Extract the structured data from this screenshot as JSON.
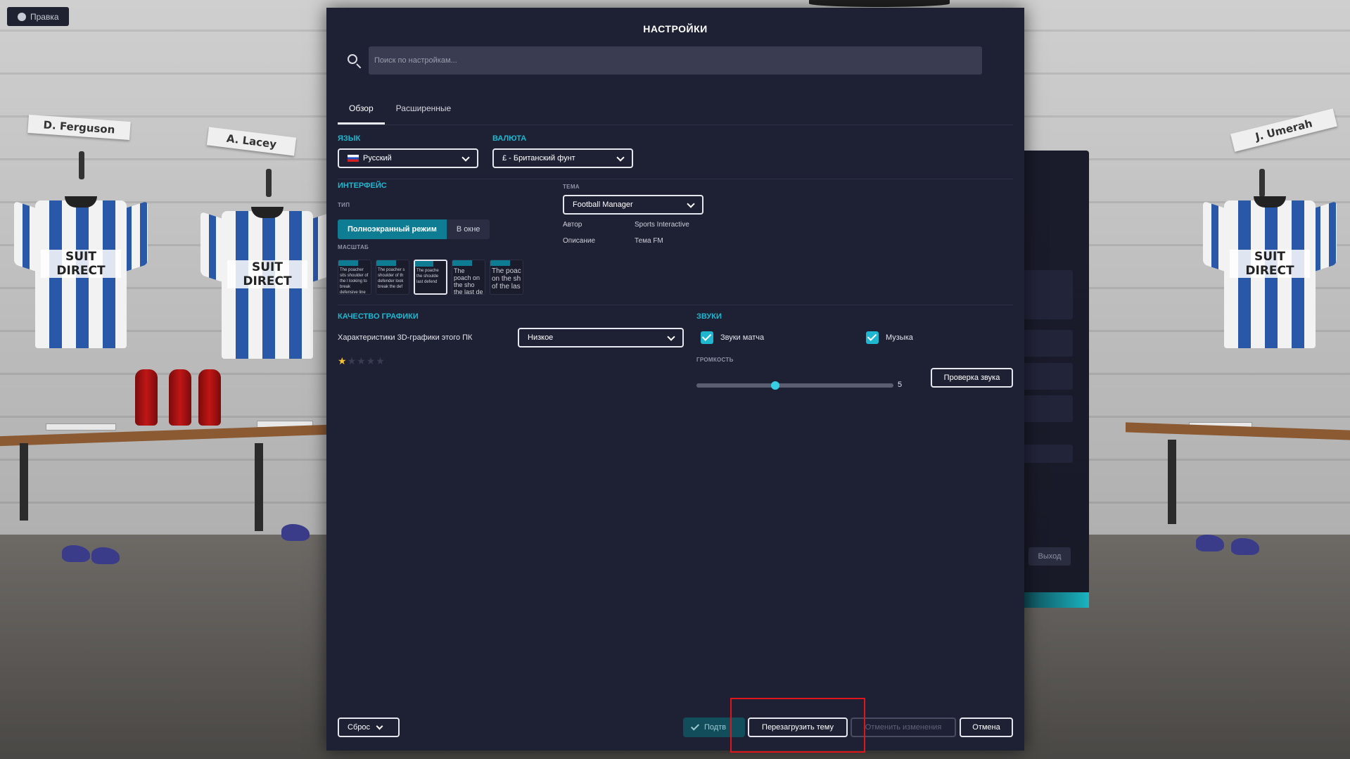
{
  "top_left": {
    "label": "Правка"
  },
  "background": {
    "nameplates": [
      "D. Ferguson",
      "A. Lacey",
      "J. Umerah"
    ],
    "shirt_sponsor": "SUIT DIRECT",
    "behind_panel": {
      "exit_label": "Выход"
    }
  },
  "dialog": {
    "title": "НАСТРОЙКИ",
    "search": {
      "placeholder": "Поиск по настройкам..."
    },
    "tabs": [
      {
        "label": "Обзор",
        "active": true
      },
      {
        "label": "Расширенные",
        "active": false
      }
    ],
    "language": {
      "heading": "ЯЗЫК",
      "value": "Русский"
    },
    "currency": {
      "heading": "ВАЛЮТА",
      "value": "£ - Британский фунт"
    },
    "interface": {
      "heading": "ИНТЕРФЕЙС",
      "type_label": "ТИП",
      "type_options": [
        "Полноэкранный режим",
        "В окне"
      ],
      "type_selected": "Полноэкранный режим",
      "scale_label": "МАСШТАБ",
      "scale_previews": [
        {
          "header": "FM",
          "text": "The poacher sits shoulder of the l looking to break defensive line ar"
        },
        {
          "header": "FM",
          "text": "The poacher s shoulder of th defender look break the def"
        },
        {
          "header": "FM",
          "text": "The poache the shoulde last defend"
        },
        {
          "header": "FM",
          "text": "The poach on the sho the last de"
        },
        {
          "header": "FM",
          "text": "The poac on the sh of the las"
        }
      ],
      "scale_selected_index": 2
    },
    "theme": {
      "label": "ТЕМА",
      "value": "Football Manager",
      "author_label": "Автор",
      "author_value": "Sports Interactive",
      "description_label": "Описание",
      "description_value": "Тема FM"
    },
    "graphics": {
      "heading": "КАЧЕСТВО ГРАФИКИ",
      "pc_label": "Характеристики 3D-графики этого ПК",
      "quality_value": "Низкое",
      "rating": 1,
      "rating_max": 5
    },
    "sounds": {
      "heading": "ЗВУКИ",
      "match_sounds_label": "Звуки матча",
      "match_sounds_checked": true,
      "music_label": "Музыка",
      "music_checked": true,
      "volume_label": "ГРОМКОСТЬ",
      "volume_value": "5",
      "volume_fraction": 0.4,
      "test_button": "Проверка звука"
    },
    "footer": {
      "reset_label": "Сброс",
      "confirm_label": "Подтв",
      "reload_theme_label": "Перезагрузить тему",
      "undo_label": "Отменить изменения",
      "cancel_label": "Отмена"
    }
  },
  "colors": {
    "dialog_bg": "#1e2133",
    "accent": "#1fb7d0",
    "segment_on": "#0e7d93",
    "highlight_box": "#e0141b"
  }
}
